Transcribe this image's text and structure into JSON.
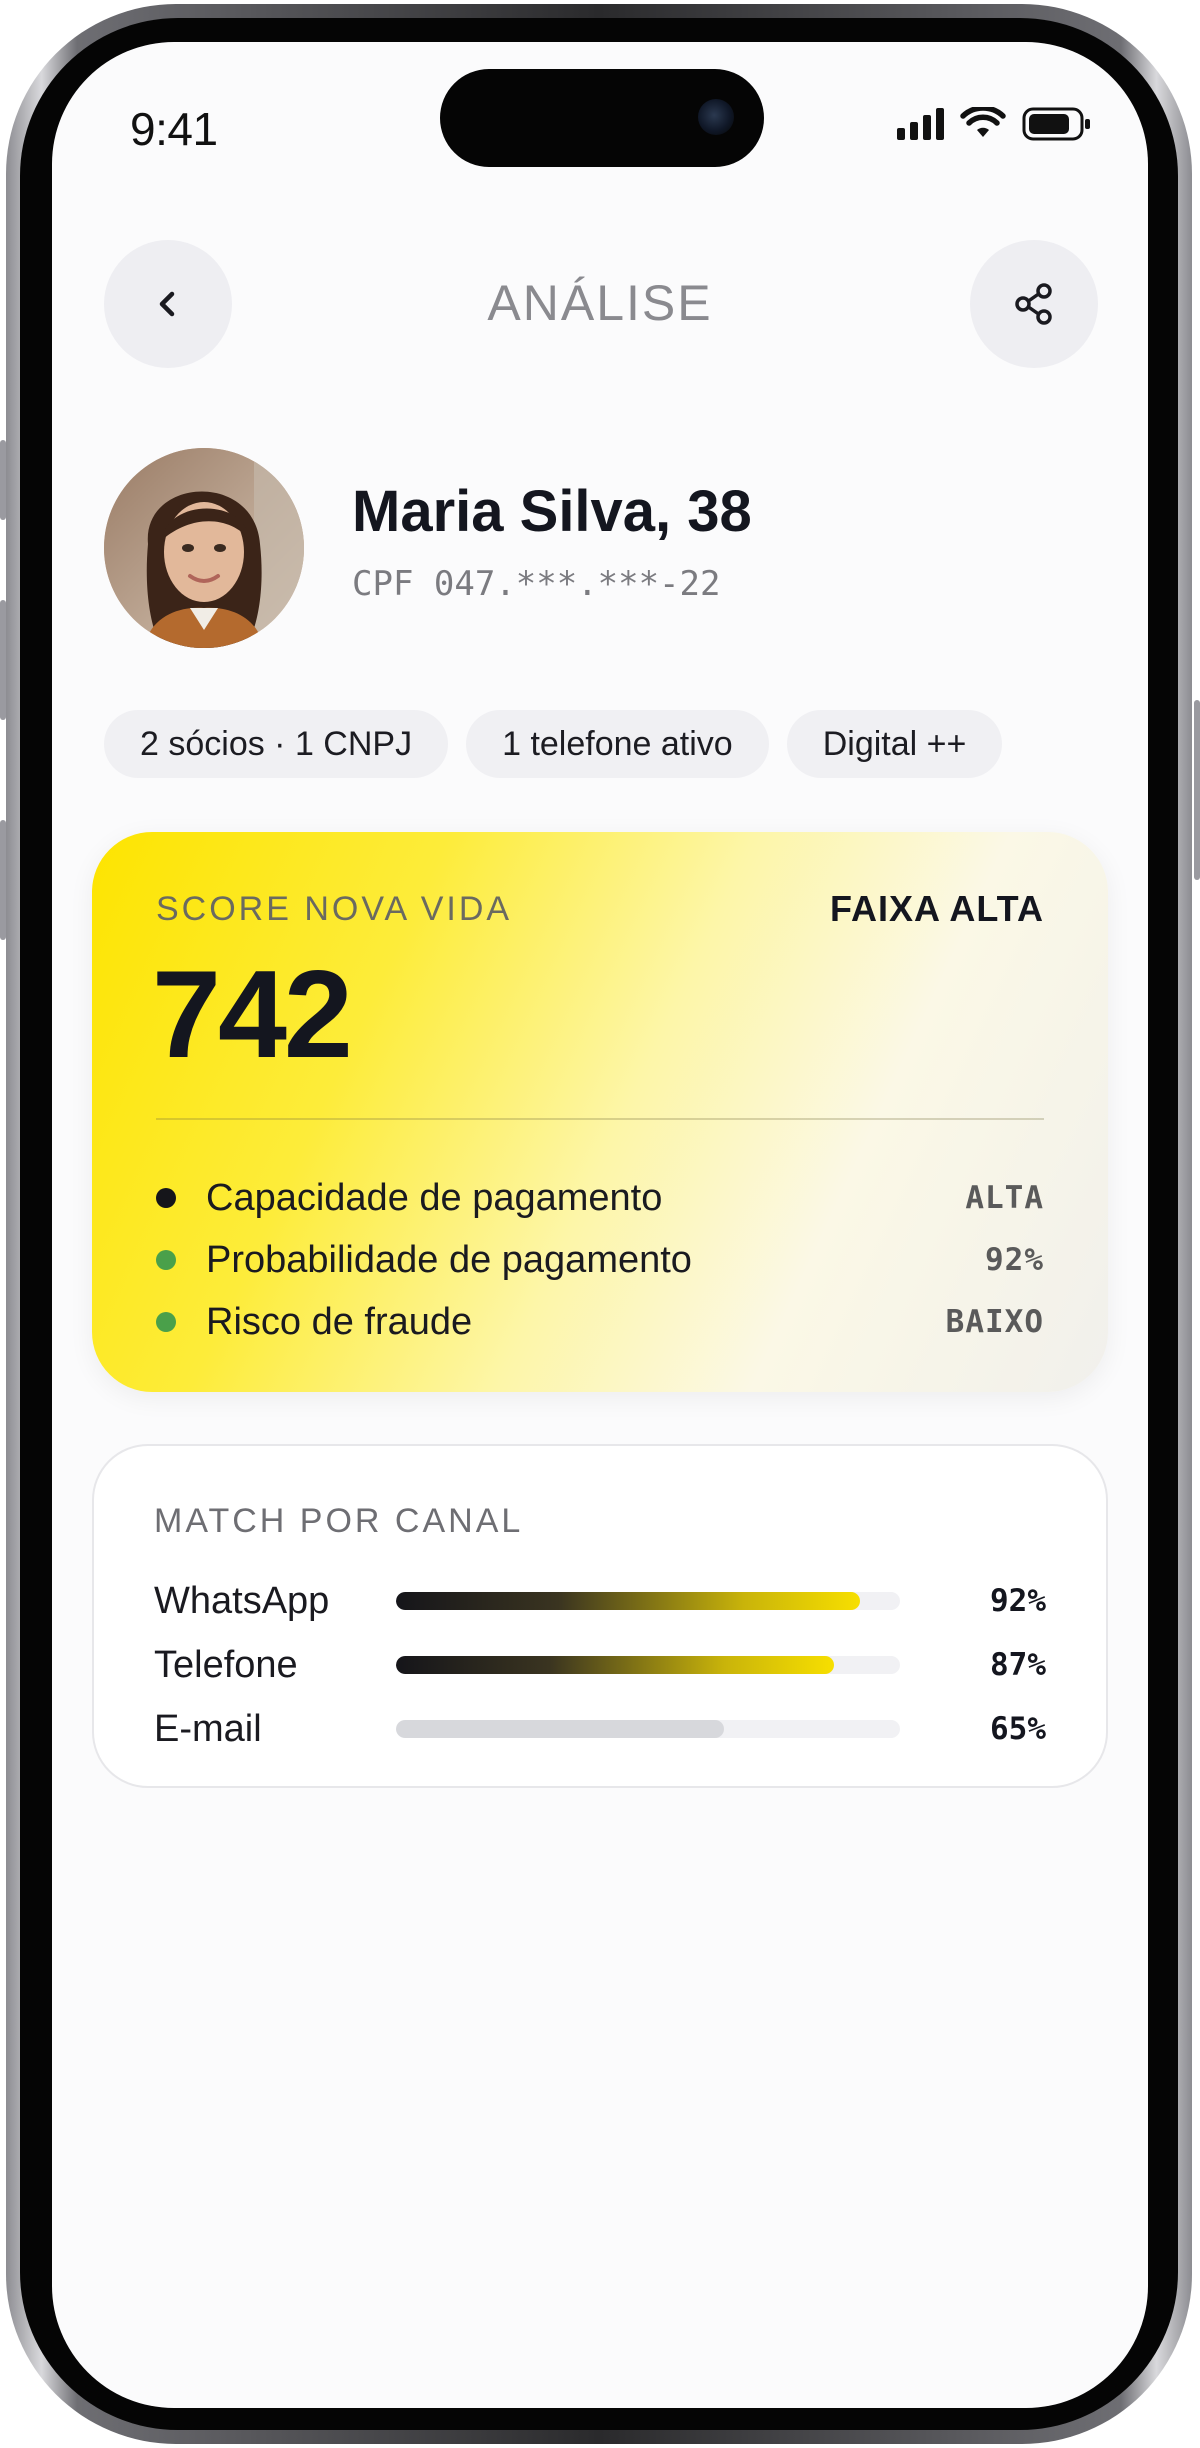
{
  "status_bar": {
    "time": "9:41"
  },
  "header": {
    "title": "ANÁLISE"
  },
  "profile": {
    "name": "Maria Silva, 38",
    "document": "CPF 047.***.***-22"
  },
  "chips": [
    "2 sócios · 1 CNPJ",
    "1 telefone ativo",
    "Digital ++"
  ],
  "score": {
    "label": "SCORE NOVA VIDA",
    "band": "FAIXA ALTA",
    "value": "742",
    "metrics": [
      {
        "label": "Capacidade de pagamento",
        "value": "ALTA",
        "dot_color": "#15151a"
      },
      {
        "label": "Probabilidade de pagamento",
        "value": "92%",
        "dot_color": "#4aa04a"
      },
      {
        "label": "Risco de fraude",
        "value": "BAIXO",
        "dot_color": "#4aa04a"
      }
    ]
  },
  "match": {
    "title": "MATCH POR CANAL",
    "rows": [
      {
        "channel": "WhatsApp",
        "pct_label": "92%",
        "level": 0.92,
        "style": "strong"
      },
      {
        "channel": "Telefone",
        "pct_label": "87%",
        "level": 0.87,
        "style": "strong"
      },
      {
        "channel": "E-mail",
        "pct_label": "65%",
        "level": 0.65,
        "style": "weak"
      }
    ]
  },
  "colors": {
    "accent_yellow": "#fde400",
    "positive_green": "#4aa04a",
    "text_dark": "#14161f"
  },
  "icons": {
    "back": "chevron-left-icon",
    "share": "share-icon"
  }
}
